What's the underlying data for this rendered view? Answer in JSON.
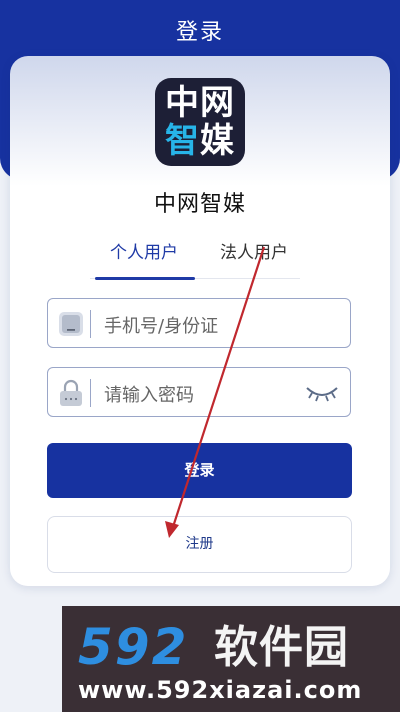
{
  "header": {
    "title": "登录"
  },
  "app": {
    "logo_row1": "中网",
    "logo_row2_a": "智",
    "logo_row2_b": "媒",
    "name": "中网智媒"
  },
  "tabs": [
    {
      "label": "个人用户",
      "active": true
    },
    {
      "label": "法人用户",
      "active": false
    }
  ],
  "form": {
    "phone_placeholder": "手机号/身份证",
    "password_placeholder": "请输入密码",
    "phone_icon": "id-card-icon",
    "password_icon": "lock-icon",
    "visibility_icon": "eye-closed-icon"
  },
  "buttons": {
    "login": "登录",
    "register": "注册"
  },
  "watermark": {
    "number": "592",
    "text": "软件园",
    "url": "www.592xiazai.com"
  },
  "colors": {
    "primary": "#1732a0",
    "logo_bg": "#1d1f36",
    "logo_accent": "#27b4e8",
    "annotation_arrow": "#c0282e"
  }
}
